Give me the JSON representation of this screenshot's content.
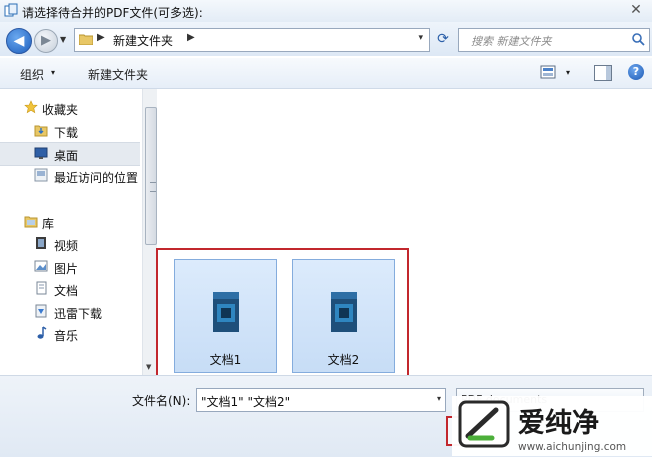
{
  "window": {
    "title": "请选择待合并的PDF文件(可多选):",
    "close_glyph": "✕"
  },
  "address": {
    "crumb": "新建文件夹",
    "separator": "▶",
    "dropdown": "▾"
  },
  "search": {
    "placeholder": "搜索 新建文件夹"
  },
  "toolbar": {
    "organize_label": "组织",
    "organize_arrow": "▾",
    "new_folder_label": "新建文件夹",
    "view_arrow": "▾",
    "help_glyph": "?"
  },
  "sidebar": {
    "favorites": {
      "label": "收藏夹",
      "items": [
        {
          "label": "下载",
          "icon": "download-folder-icon"
        },
        {
          "label": "桌面",
          "icon": "desktop-icon",
          "selected": true
        },
        {
          "label": "最近访问的位置",
          "icon": "recent-places-icon"
        }
      ]
    },
    "libraries": {
      "label": "库",
      "items": [
        {
          "label": "视频",
          "icon": "video-library-icon"
        },
        {
          "label": "图片",
          "icon": "picture-library-icon"
        },
        {
          "label": "文档",
          "icon": "document-library-icon"
        },
        {
          "label": "迅雷下载",
          "icon": "xunlei-folder-icon"
        },
        {
          "label": "音乐",
          "icon": "music-library-icon"
        }
      ]
    }
  },
  "files": [
    {
      "name": "文档1",
      "selected": true
    },
    {
      "name": "文档2",
      "selected": true
    }
  ],
  "bottom": {
    "filename_label": "文件名(N):",
    "filename_value": "\"文档1\" \"文档2\"",
    "filename_dropdown": "▾",
    "filter_value": "PDF documents"
  },
  "watermark": {
    "brand": "爱纯净",
    "url": "www.aichunjing.com"
  },
  "colors": {
    "highlight_border": "#c2272d",
    "tile_fill": "#c7ddf6",
    "accent_blue": "#1e5fbd"
  }
}
